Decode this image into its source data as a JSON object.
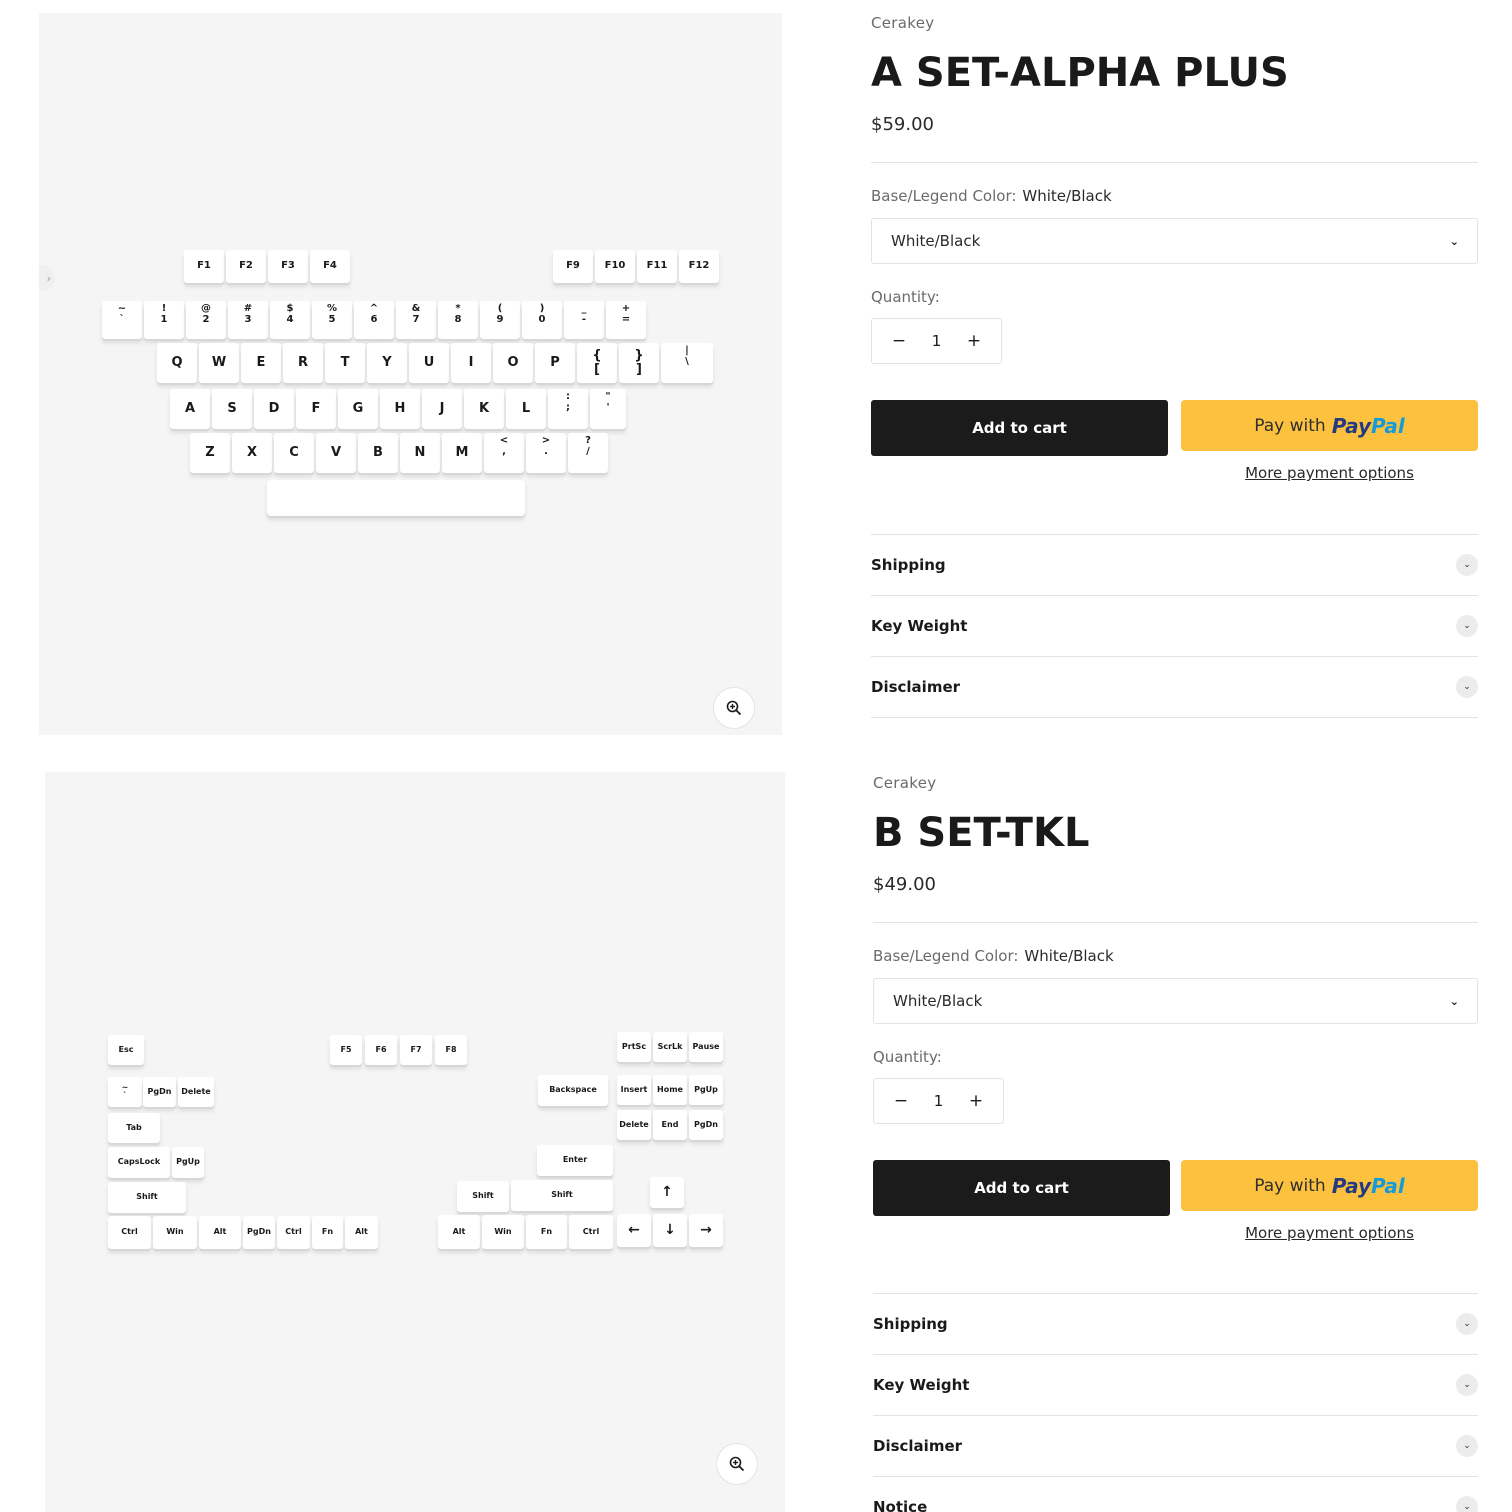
{
  "products": [
    {
      "vendor": "Cerakey",
      "title": "A SET-ALPHA PLUS",
      "price": "$59.00",
      "option_label": "Base/Legend Color:",
      "option_value": "White/Black",
      "select_value": "White/Black",
      "quantity_label": "Quantity:",
      "quantity": "1",
      "add_to_cart": "Add to cart",
      "paypal_prefix": "Pay with",
      "paypal_brand_1": "Pay",
      "paypal_brand_2": "Pal",
      "more_payment": "More payment options",
      "accordion": [
        "Shipping",
        "Key Weight",
        "Disclaimer"
      ]
    },
    {
      "vendor": "Cerakey",
      "title": "B SET-TKL",
      "price": "$49.00",
      "option_label": "Base/Legend Color:",
      "option_value": "White/Black",
      "select_value": "White/Black",
      "quantity_label": "Quantity:",
      "quantity": "1",
      "add_to_cart": "Add to cart",
      "paypal_prefix": "Pay with",
      "paypal_brand_1": "Pay",
      "paypal_brand_2": "Pal",
      "more_payment": "More payment options",
      "accordion": [
        "Shipping",
        "Key Weight",
        "Disclaimer",
        "Notice"
      ]
    }
  ],
  "icons": {
    "minus": "−",
    "plus": "+",
    "chevron_down": "⌄",
    "zoom": "zoom-in-icon",
    "slider_prev": "›"
  },
  "keycaps_a": {
    "f_left": [
      "F1",
      "F2",
      "F3",
      "F4"
    ],
    "f_right": [
      "F9",
      "F10",
      "F11",
      "F12"
    ],
    "number_row": [
      "~\n`",
      "!\n1",
      "@\n2",
      "#\n3",
      "$\n4",
      "%\n5",
      "^\n6",
      "&\n7",
      "*\n8",
      "(\n9",
      ")\n0",
      "_\n-",
      "+\n="
    ],
    "qwerty_row": [
      "Q",
      "W",
      "E",
      "R",
      "T",
      "Y",
      "U",
      "I",
      "O",
      "P",
      "{\n[",
      "}\n]",
      "|\n\\"
    ],
    "home_row": [
      "A",
      "S",
      "D",
      "F",
      "G",
      "H",
      "J",
      "K",
      "L",
      ":\n;",
      "\"\n'"
    ],
    "bottom_row": [
      "Z",
      "X",
      "C",
      "V",
      "B",
      "N",
      "M",
      "<\n,",
      ">\n.",
      "?\n/"
    ]
  },
  "keycaps_b": {
    "esc": "Esc",
    "f_mid": [
      "F5",
      "F6",
      "F7",
      "F8"
    ],
    "nav_top": [
      "PrtSc",
      "ScrLk",
      "Pause"
    ],
    "tilde": "~\n`",
    "pgdn": "PgDn",
    "delete": "Delete",
    "backspace": "Backspace",
    "nav_mid": [
      "Insert",
      "Home",
      "PgUp"
    ],
    "tab": "Tab",
    "nav_low": [
      "Delete",
      "End",
      "PgDn"
    ],
    "capslock": "CapsLock",
    "pgup": "PgUp",
    "enter": "Enter",
    "shift_left": "Shift",
    "shift_mid": "Shift",
    "shift_right": "Shift",
    "arrow_up": "↑",
    "bottom_left": [
      "Ctrl",
      "Win",
      "Alt",
      "PgDn",
      "Ctrl",
      "Fn",
      "Alt"
    ],
    "bottom_right": [
      "Alt",
      "Win",
      "Fn",
      "Ctrl"
    ],
    "arrows": [
      "←",
      "↓",
      "→"
    ]
  }
}
